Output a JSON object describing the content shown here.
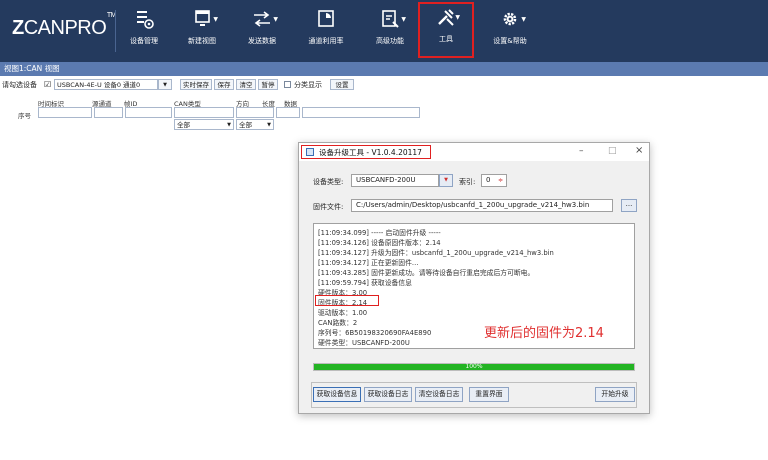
{
  "brand": {
    "logo_text": "CANPRO",
    "logo_z": "Z",
    "trademark": "TM"
  },
  "toolbar": [
    {
      "id": "device-mgmt",
      "label": "设备管理",
      "icon": "device-icon",
      "dropdown": false
    },
    {
      "id": "new-view",
      "label": "新建视图",
      "icon": "new-view-icon",
      "dropdown": true
    },
    {
      "id": "send-data",
      "label": "发送数据",
      "icon": "send-icon",
      "dropdown": true
    },
    {
      "id": "channel-usage",
      "label": "通道利用率",
      "icon": "usage-icon",
      "dropdown": false
    },
    {
      "id": "advanced",
      "label": "高级功能",
      "icon": "advanced-icon",
      "dropdown": true
    },
    {
      "id": "tools",
      "label": "工具",
      "icon": "tools-icon",
      "dropdown": true,
      "active": true
    },
    {
      "id": "settings-help",
      "label": "设置&帮助",
      "icon": "gear-icon",
      "dropdown": true
    }
  ],
  "view": {
    "title": "视图1:CAN 视图",
    "filter_device_label": "请勾选设备",
    "device_checked_mark": "☑",
    "device_value": "USBCAN-4E-U 设备0 通道0",
    "btn_realtime_save": "实时保存",
    "btn_save": "保存",
    "btn_clear": "清空",
    "btn_pause": "暂停",
    "split_display_label": "分类显示",
    "btn_settings": "设置",
    "row_label": "序号",
    "columns": [
      "时间标识",
      "源通道",
      "帧ID",
      "CAN类型",
      "方向",
      "长度",
      "数据"
    ],
    "can_type_value": "全部",
    "direction_value": "全部"
  },
  "dialog": {
    "title": "设备升级工具 - V1.0.4.20117",
    "win_minimize": "–",
    "win_maximize": "□",
    "win_close": "×",
    "device_type_label": "设备类型:",
    "device_type_value": "USBCANFD-200U",
    "index_label": "索引:",
    "index_value": "0",
    "firmware_file_label": "固件文件:",
    "firmware_file_value": "C:/Users/admin/Desktop/usbcanfd_1_200u_upgrade_v214_hw3.bin",
    "browse_label": "...",
    "log_lines": [
      "[11:09:34.099] ----- 启动固件升级 -----",
      "[11:09:34.126] 设备原固件版本：2.14",
      "[11:09:34.127] 升级为固件：usbcanfd_1_200u_upgrade_v214_hw3.bin",
      "[11:09:34.127] 正在更新固件...",
      "[11:09:43.285] 固件更新成功。请等待设备自行重启完成后方可断电。",
      "[11:09:59.794] 获取设备信息",
      "硬件版本：3.00",
      "固件版本：2.14",
      "驱动版本：1.00",
      "CAN路数：2",
      "序列号：6B50198320690FA4E890",
      "硬件类型：USBCANFD-200U"
    ],
    "annotation": "更新后的固件为2.14",
    "progress_percent": 100,
    "progress_text": "100%",
    "btn_get_info": "获取设备信息",
    "btn_get_log": "获取设备日志",
    "btn_clear_log": "清空设备日志",
    "btn_reset_ui": "重置界面",
    "btn_start": "开始升级"
  },
  "colors": {
    "toolbar_bg": "#243a5e",
    "viewbar_bg": "#5b7ab0",
    "highlight_red": "#e02020",
    "progress_green": "#23b423"
  }
}
